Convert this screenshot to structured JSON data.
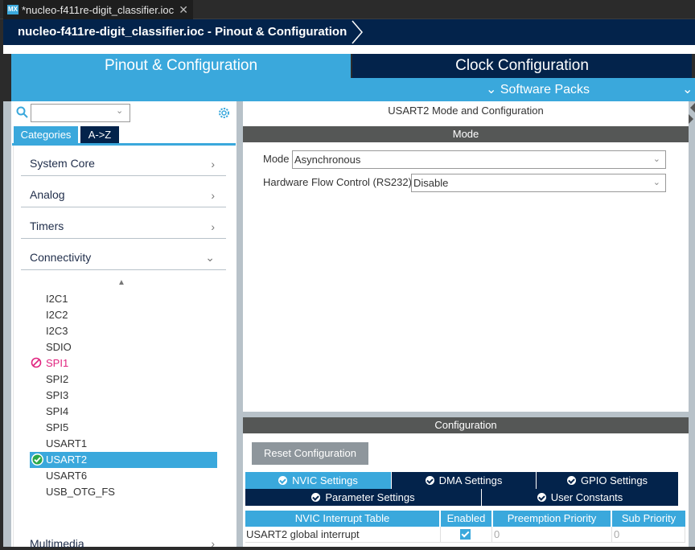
{
  "editor_tab": {
    "icon": "MX",
    "title": "*nucleo-f411re-digit_classifier.ioc",
    "close": "✕"
  },
  "breadcrumb": {
    "text": "nucleo-f411re-digit_classifier.ioc - Pinout & Configuration"
  },
  "main_tabs": {
    "pinout": "Pinout & Configuration",
    "clock": "Clock Configuration"
  },
  "subbar": {
    "software_packs": "Software Packs"
  },
  "left": {
    "search_value": "",
    "tabs": {
      "categories": "Categories",
      "az": "A->Z"
    },
    "categories": [
      {
        "label": "System Core",
        "state": "collapsed"
      },
      {
        "label": "Analog",
        "state": "collapsed"
      },
      {
        "label": "Timers",
        "state": "collapsed"
      },
      {
        "label": "Connectivity",
        "state": "expanded"
      }
    ],
    "peripherals": [
      {
        "label": "I2C1",
        "status": "none"
      },
      {
        "label": "I2C2",
        "status": "none"
      },
      {
        "label": "I2C3",
        "status": "none"
      },
      {
        "label": "SDIO",
        "status": "none"
      },
      {
        "label": "SPI1",
        "status": "conflict"
      },
      {
        "label": "SPI2",
        "status": "none"
      },
      {
        "label": "SPI3",
        "status": "none"
      },
      {
        "label": "SPI4",
        "status": "none"
      },
      {
        "label": "SPI5",
        "status": "none"
      },
      {
        "label": "USART1",
        "status": "none"
      },
      {
        "label": "USART2",
        "status": "configured",
        "selected": true
      },
      {
        "label": "USART6",
        "status": "none"
      },
      {
        "label": "USB_OTG_FS",
        "status": "none"
      }
    ],
    "multimedia": "Multimedia"
  },
  "mode_panel": {
    "title": "USART2 Mode and Configuration",
    "section": "Mode",
    "mode_label": "Mode",
    "mode_value": "Asynchronous",
    "hfc_label": "Hardware Flow Control (RS232)",
    "hfc_value": "Disable"
  },
  "config_panel": {
    "section": "Configuration",
    "reset": "Reset Configuration",
    "tabs_row1": [
      "NVIC Settings",
      "DMA Settings",
      "GPIO Settings"
    ],
    "tabs_row2": [
      "Parameter Settings",
      "User Constants"
    ],
    "active_tab": "NVIC Settings",
    "table": {
      "headers": [
        "NVIC Interrupt Table",
        "Enabled",
        "Preemption Priority",
        "Sub Priority"
      ],
      "rows": [
        {
          "name": "USART2 global interrupt",
          "enabled": true,
          "preemption": "0",
          "sub": "0"
        }
      ]
    }
  },
  "colors": {
    "accent": "#3aa8dc",
    "navy": "#03234b",
    "section_bar": "#555756",
    "conflict": "#e0247f",
    "ok": "#2aa84a"
  }
}
